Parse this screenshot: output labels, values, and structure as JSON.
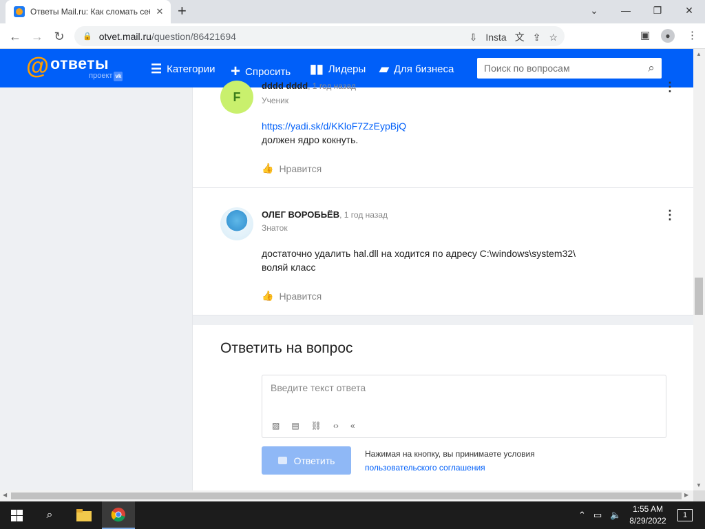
{
  "browser": {
    "tab_title": "Ответы Mail.ru: Как сломать себ...",
    "url_host": "otvet.mail.ru",
    "url_path": "/question/86421694",
    "install_label": "Insta",
    "icons": [
      "lock-icon",
      "install-icon",
      "translate-icon",
      "share-icon",
      "star-icon",
      "sidebar-icon",
      "profile-icon",
      "menu-icon"
    ]
  },
  "header": {
    "logo_text": "ответы",
    "logo_sub": "проект",
    "logo_badge": "vk",
    "nav": [
      {
        "label": "Категории",
        "icon": "list-icon"
      },
      {
        "label": "Спросить",
        "icon": "plus-icon"
      },
      {
        "label": "Лидеры",
        "icon": "bars-icon"
      },
      {
        "label": "Для бизнеса",
        "icon": "briefcase-icon"
      }
    ],
    "search_placeholder": "Поиск по вопросам"
  },
  "answers": [
    {
      "author": "dddd dddd",
      "time": ", 1 год назад",
      "rank": "Ученик",
      "avatar_letter": "F",
      "avatar_color": "#c9f06d",
      "link": "https://yadi.sk/d/KKloF7ZzEypBjQ",
      "text": "должен ядро кокнуть.",
      "like_label": "Нравится"
    },
    {
      "author": "ОЛЕГ ВОРОБЬЁВ",
      "time": ", 1 год назад",
      "rank": "Знаток",
      "text_line1": "достаточно удалить hal.dll на ходится по адресу C:\\windows\\system32\\",
      "text_line2": "воляй класс",
      "like_label": "Нравится"
    }
  ],
  "reply": {
    "title": "Ответить на вопрос",
    "placeholder": "Введите текст ответа",
    "submit_label": "Ответить",
    "terms_text": "Нажимая на кнопку, вы принимаете условия",
    "terms_link": "пользовательского соглашения"
  },
  "taskbar": {
    "time": "1:55 AM",
    "date": "8/29/2022",
    "notification_count": "1"
  },
  "colors": {
    "brand": "#005ff9",
    "accent": "#ff9e00",
    "button_disabled": "#8fb8f6"
  }
}
